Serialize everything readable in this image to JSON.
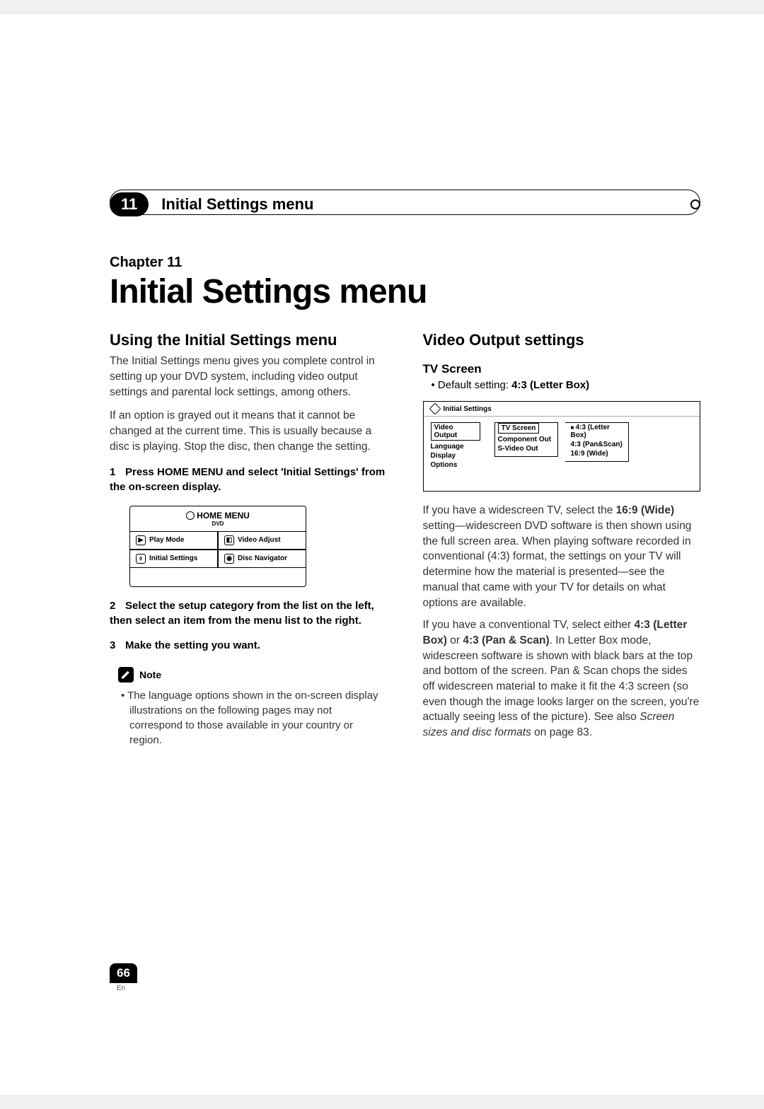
{
  "header": {
    "chapter_num": "11",
    "header_title": "Initial Settings menu"
  },
  "chapter": {
    "label": "Chapter 11",
    "title": "Initial Settings menu"
  },
  "left": {
    "h2": "Using the Initial Settings menu",
    "p1": "The Initial Settings menu gives you complete control in setting up your DVD system, including video output settings and parental lock settings, among others.",
    "p2": "If an option is grayed out it means that it cannot be changed at the current time. This is usually because a disc is playing. Stop the disc, then change the setting.",
    "step1_num": "1",
    "step1": "Press HOME MENU and select 'Initial Settings' from the on-screen display.",
    "home_menu": {
      "title": "HOME MENU",
      "sub": "DVD",
      "items": [
        "Play Mode",
        "Video Adjust",
        "Initial Settings",
        "Disc Navigator"
      ]
    },
    "step2_num": "2",
    "step2": "Select the setup category from the list on the left, then select an item from the menu list to the right.",
    "step3_num": "3",
    "step3": "Make the setting you want.",
    "note_label": "Note",
    "note_text": "• The language options shown in the on-screen display illustrations on the following pages may not correspond to those available in your country or region."
  },
  "right": {
    "h2": "Video Output settings",
    "h3": "TV Screen",
    "default_prefix": "• Default setting: ",
    "default_value": "4:3 (Letter Box)",
    "settings_box": {
      "title": "Initial Settings",
      "col1": [
        "Video Output",
        "Language",
        "Display",
        "Options"
      ],
      "col2": [
        "TV Screen",
        "Component Out",
        "S-Video Out"
      ],
      "col3": [
        "4:3 (Letter Box)",
        "4:3 (Pan&Scan)",
        "16:9 (Wide)"
      ]
    },
    "p1a": "If you have a widescreen TV, select the ",
    "p1b": "16:9 (Wide)",
    "p1c": " setting—widescreen DVD software is then shown using the full screen area. When playing software recorded in conventional (4:3) format, the settings on your TV will determine how the material is presented—see the manual that came with your TV for details on what options are available.",
    "p2a": "If you have a conventional TV, select either ",
    "p2b": "4:3 (Letter Box)",
    "p2c": " or ",
    "p2d": "4:3 (Pan & Scan)",
    "p2e": ". In Letter Box mode, widescreen software is shown with black bars at the top and bottom of the screen. Pan & Scan chops the sides off widescreen material to make it fit the 4:3 screen (so even though the image looks larger on the screen, you're actually seeing less of the picture). See also ",
    "p2f": "Screen sizes and disc formats",
    "p2g": " on page 83."
  },
  "footer": {
    "page_num": "66",
    "lang": "En"
  }
}
